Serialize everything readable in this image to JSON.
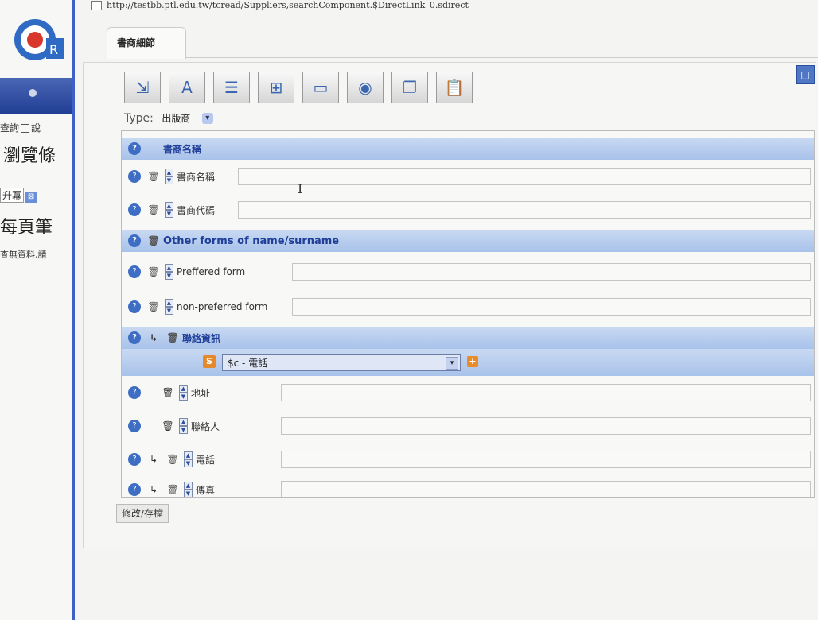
{
  "browser": {
    "url": "http://testbb.ptl.edu.tw/tcread/Suppliers,searchComponent.$DirectLink_0.sdirect"
  },
  "left_page": {
    "logo_text": "OR",
    "query_label": "查詢",
    "query_checkbox_label": "說",
    "title": "瀏覽條",
    "sort_value": "升冪",
    "pager_label": "每頁筆",
    "nodata_text": "查無資料,請"
  },
  "window": {
    "tab_label": "書商細節",
    "maximize_label": "□",
    "type_label": "Type:",
    "type_value": "出版商",
    "save_button": "修改/存檔"
  },
  "toolbar": {
    "buttons": [
      {
        "name": "export-icon",
        "glyph": "⇲"
      },
      {
        "name": "font-icon",
        "glyph": "A"
      },
      {
        "name": "list-icon",
        "glyph": "☰"
      },
      {
        "name": "tree-icon",
        "glyph": "⊞"
      },
      {
        "name": "document-icon",
        "glyph": "▭"
      },
      {
        "name": "disc-icon",
        "glyph": "◉"
      },
      {
        "name": "copy-icon",
        "glyph": "❐"
      },
      {
        "name": "paste-icon",
        "glyph": "📋"
      }
    ]
  },
  "form": {
    "section_name": {
      "title": "書商名稱"
    },
    "field_name": {
      "label": "書商名稱"
    },
    "field_code": {
      "label": "書商代碼"
    },
    "section_other": {
      "title": "Other forms of name/surname"
    },
    "field_preferred": {
      "label": "Preffered form"
    },
    "field_nonpreferred": {
      "label": "non-preferred form"
    },
    "section_contact": {
      "title": "聯絡資訊"
    },
    "contact_select": {
      "value": "$c - 電話"
    },
    "field_address": {
      "label": "地址"
    },
    "field_contact_person": {
      "label": "聯絡人"
    },
    "field_phone": {
      "label": "電話"
    },
    "field_fax": {
      "label": "傳真"
    }
  },
  "colors": {
    "header_blue": "#a8c2ea",
    "window_border": "#3d5fc7",
    "accent_orange": "#e48a2d"
  }
}
